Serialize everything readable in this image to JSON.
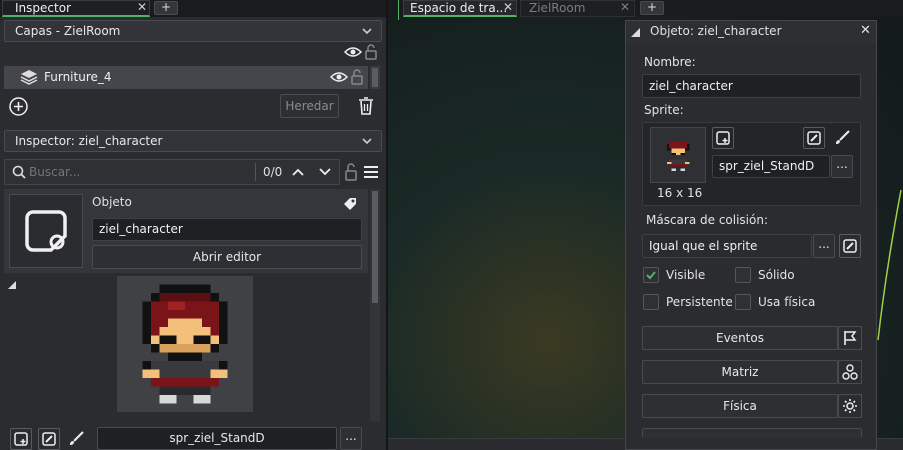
{
  "left": {
    "tab_title": "Inspector",
    "tab_close": "✕",
    "tab_add": "+",
    "layers_dropdown": "Capas - ZielRoom",
    "layer_row": {
      "name": "Furniture_4"
    },
    "inherit_button": "Heredar",
    "inspector_dropdown": "Inspector: ziel_character",
    "search_placeholder": "Buscar...",
    "search_count": "0/0",
    "object": {
      "section_label": "Objeto",
      "name_value": "ziel_character",
      "open_editor": "Abrir editor"
    },
    "bottom_sprite_name": "spr_ziel_StandD",
    "more_button": "..."
  },
  "workspace": {
    "tabs": [
      {
        "label": "Espacio de tra..."
      },
      {
        "label": "ZielRoom"
      }
    ],
    "tab_add": "+"
  },
  "object_window": {
    "title": "Objeto: ziel_character",
    "name_label": "Nombre:",
    "name_value": "ziel_character",
    "sprite_label": "Sprite:",
    "sprite_size": "16 x 16",
    "sprite_name": "spr_ziel_StandD",
    "more_button": "...",
    "collision_label": "Máscara de colisión:",
    "collision_value": "Igual que el sprite",
    "checks": {
      "visible": {
        "label": "Visible",
        "checked": true
      },
      "solid": {
        "label": "Sólido",
        "checked": false
      },
      "persistent": {
        "label": "Persistente",
        "checked": false
      },
      "physics": {
        "label": "Usa física",
        "checked": false
      }
    },
    "buttons": {
      "events": "Eventos",
      "matrix": "Matriz",
      "physics": "Física"
    }
  },
  "colors": {
    "accent_green": "#4fb36a",
    "panel": "#2b2c30",
    "field": "#1f2023"
  }
}
